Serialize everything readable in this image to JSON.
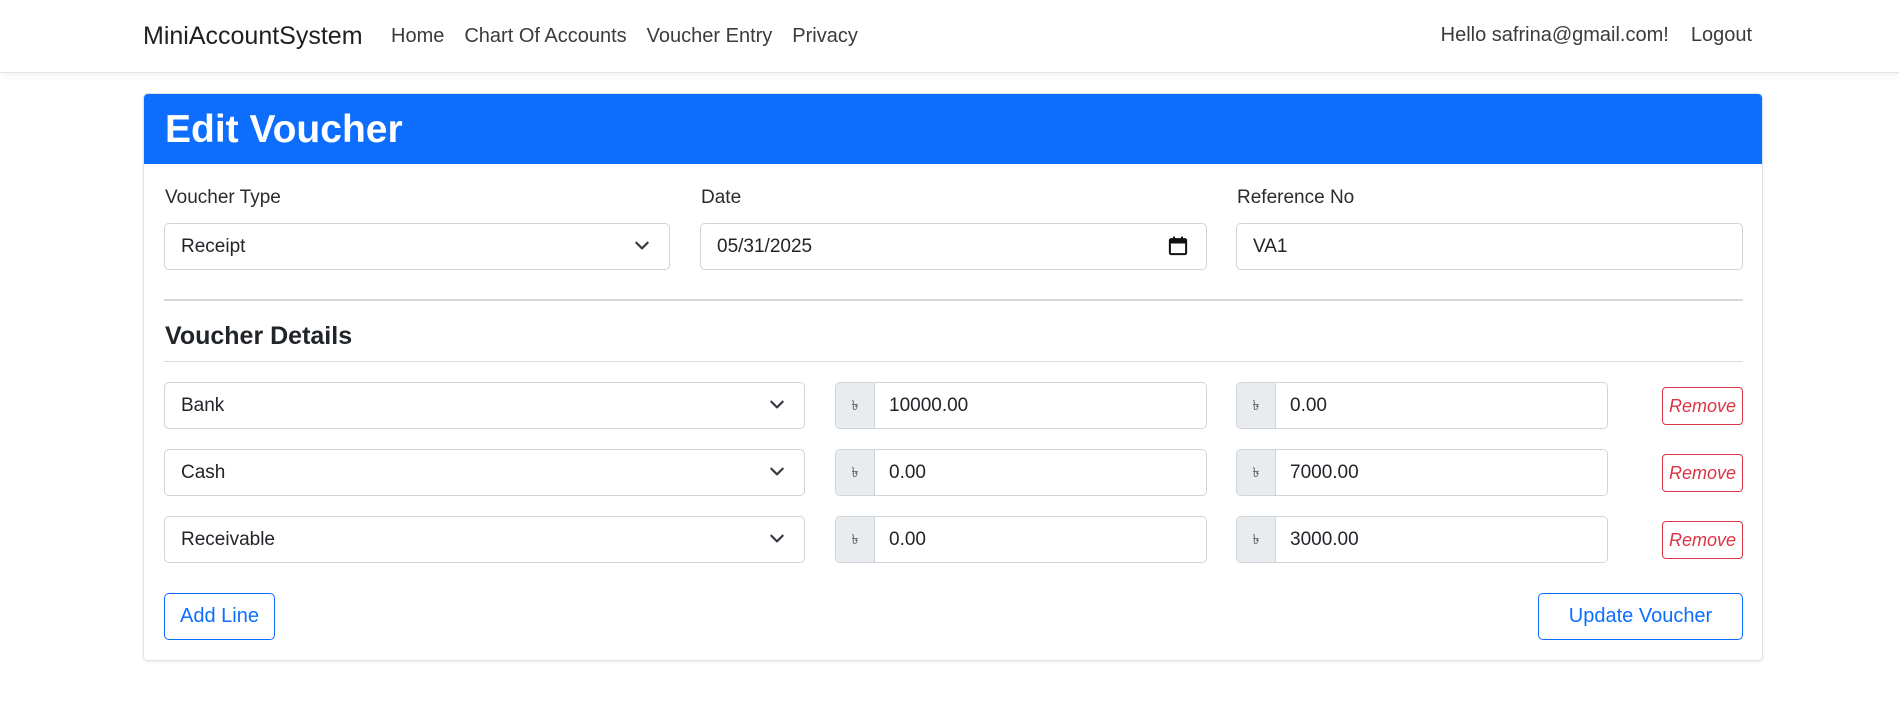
{
  "navbar": {
    "brand": "MiniAccountSystem",
    "links": [
      "Home",
      "Chart Of Accounts",
      "Voucher Entry",
      "Privacy"
    ],
    "greeting": "Hello safrina@gmail.com!",
    "logout": "Logout"
  },
  "form": {
    "title": "Edit Voucher",
    "voucher_type_label": "Voucher Type",
    "voucher_type_value": "Receipt",
    "date_label": "Date",
    "date_value": "05/31/2025",
    "reference_label": "Reference No",
    "reference_value": "VA1",
    "details_title": "Voucher Details",
    "currency_symbol": "৳",
    "remove_label": "Remove",
    "lines": [
      {
        "account": "Bank",
        "debit": "10000.00",
        "credit": "0.00"
      },
      {
        "account": "Cash",
        "debit": "0.00",
        "credit": "7000.00"
      },
      {
        "account": "Receivable",
        "debit": "0.00",
        "credit": "3000.00"
      }
    ],
    "add_line_label": "Add Line",
    "update_label": "Update Voucher"
  },
  "colors": {
    "primary": "#0d6efd",
    "danger": "#dc3545",
    "addon_bg": "#e9ecef"
  }
}
